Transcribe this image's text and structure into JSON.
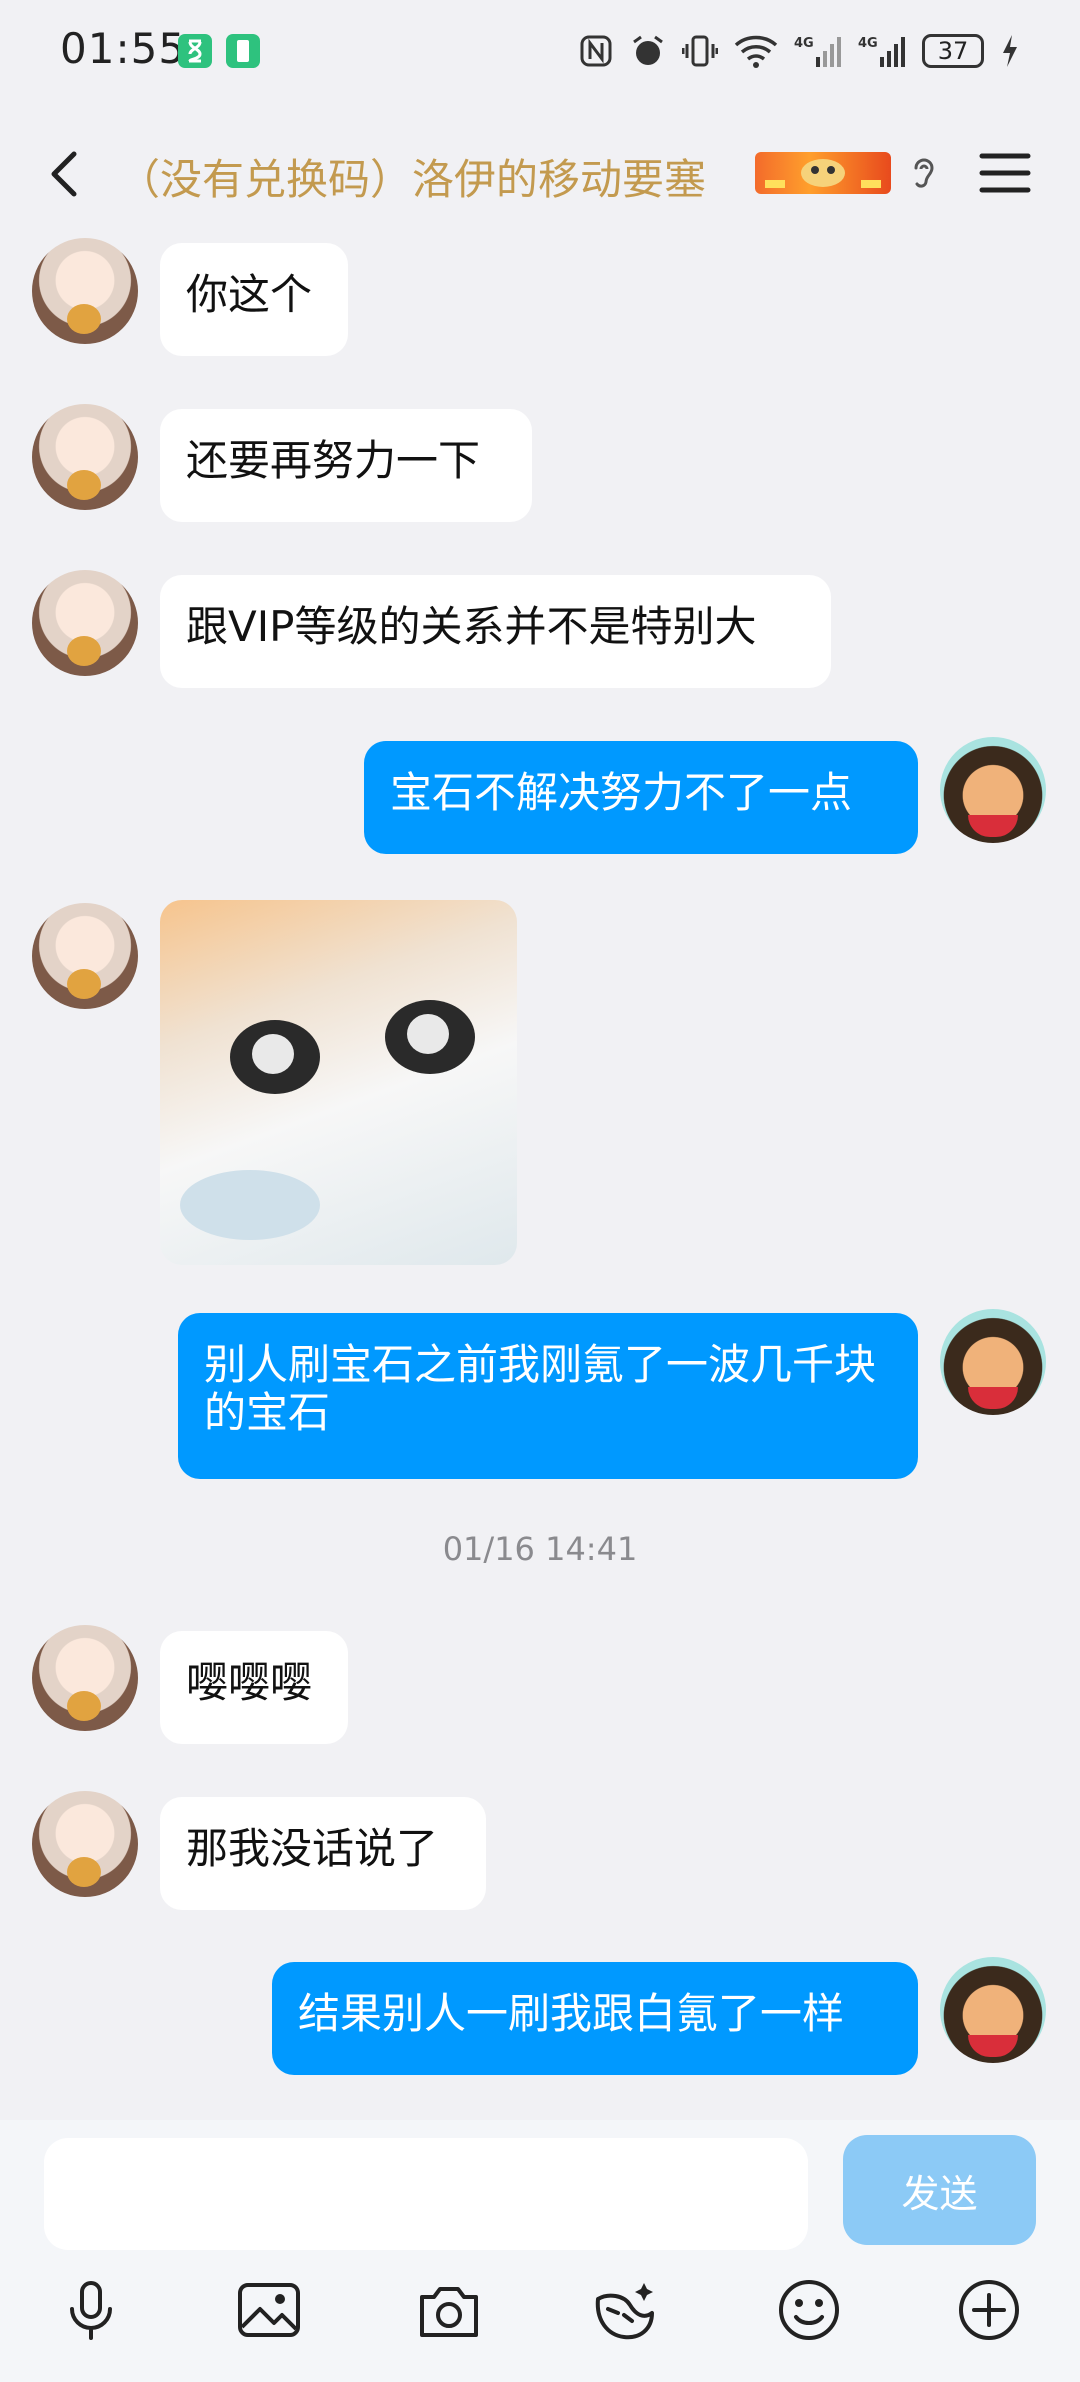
{
  "status_bar": {
    "time": "01:55",
    "battery": "37",
    "network1": "4G",
    "network2": "4G"
  },
  "header": {
    "title": "（没有兑换码）洛伊的移动要塞"
  },
  "messages": [
    {
      "side": "in",
      "text": "你这个"
    },
    {
      "side": "in",
      "text": "还要再努力一下"
    },
    {
      "side": "in",
      "text": "跟VIP等级的关系并不是特别大"
    },
    {
      "side": "out",
      "text": "宝石不解决努力不了一点"
    },
    {
      "side": "in",
      "type": "sticker"
    },
    {
      "side": "out",
      "text": "别人刷宝石之前我刚氪了一波几千块的宝石"
    },
    {
      "side": "in",
      "text": "嘤嘤嘤"
    },
    {
      "side": "in",
      "text": "那我没话说了"
    },
    {
      "side": "out",
      "text": "结果别人一刷我跟白氪了一样"
    }
  ],
  "timestamp": "01/16 14:41",
  "input": {
    "placeholder": "",
    "send_label": "发送"
  },
  "toolbar_icons": [
    "microphone-icon",
    "image-icon",
    "camera-icon",
    "mask-icon",
    "emoji-icon",
    "plus-icon"
  ],
  "colors": {
    "accent": "#0099ff",
    "title": "#c39a4f",
    "send_disabled": "#8ccaf6"
  }
}
